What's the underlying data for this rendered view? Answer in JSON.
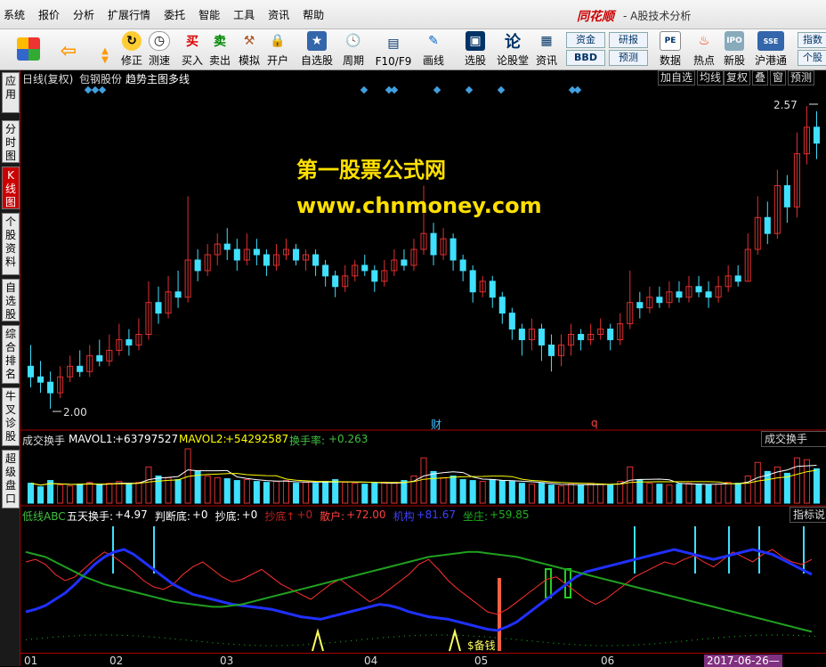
{
  "menubar": {
    "items": [
      "系统",
      "报价",
      "分析",
      "扩展行情",
      "委托",
      "智能",
      "工具",
      "资讯",
      "帮助"
    ],
    "brand": "同花顺",
    "subtitle": "- A股技术分析"
  },
  "toolbar": {
    "buttons": [
      {
        "label": "修正"
      },
      {
        "label": "测速"
      },
      {
        "label": "买入"
      },
      {
        "label": "卖出"
      },
      {
        "label": "模拟"
      },
      {
        "label": "开户"
      },
      {
        "label": "自选股"
      },
      {
        "label": "周期"
      },
      {
        "label": "F10/F9"
      },
      {
        "label": "画线"
      },
      {
        "label": "选股"
      },
      {
        "label": "论股堂"
      },
      {
        "label": "资讯"
      },
      {
        "label": "数据"
      },
      {
        "label": "热点"
      },
      {
        "label": "新股"
      },
      {
        "label": "沪港通"
      },
      {
        "label": "个股"
      }
    ],
    "boxes": [
      "资金",
      "研报",
      "BBD",
      "预测",
      "指数"
    ],
    "icon_glyphs": {
      "buy": "买",
      "sell": "卖",
      "lun": "论"
    }
  },
  "sidetabs": [
    "应用",
    "分时图",
    "K线图",
    "个股资料",
    "自选股",
    "综合排名",
    "牛叉诊股",
    "超级盘口"
  ],
  "header": {
    "period": "日线(复权)",
    "stock": "包钢股份",
    "indicator": "趋势主图多线",
    "buttons": [
      "加自选",
      "均线",
      "复权",
      "叠",
      "窗",
      "预测"
    ]
  },
  "watermark": {
    "line1": "第一股票公式网",
    "line2": "www.chnmoney.com"
  },
  "kline": {
    "high_label": "2.57",
    "low_label": "2.00",
    "markers": [
      "财",
      "q"
    ]
  },
  "volume_panel": {
    "name": "成交换手",
    "mavol1_label": "MAVOL1:",
    "mavol1_value": "+63797527",
    "mavol2_label": "MAVOL2:",
    "mavol2_value": "+54292587",
    "turnover_label": "换手率:",
    "turnover_value": "+0.263",
    "right_button": "成交换手"
  },
  "indicator_panel": {
    "name": "低线ABC",
    "items": [
      {
        "label": "五天换手:",
        "value": "+4.97",
        "color": "#ffffff"
      },
      {
        "label": "判断底:",
        "value": "+0",
        "color": "#ffffff"
      },
      {
        "label": "抄底:",
        "value": "+0",
        "color": "#ffffff"
      },
      {
        "label": "抄底↑",
        "value": "+0",
        "color": "#c02020"
      },
      {
        "label": "散户:",
        "value": "+72.00",
        "color": "#ff4040"
      },
      {
        "label": "机构",
        "value": "+81.67",
        "color": "#4040ff"
      },
      {
        "label": "坐庄:",
        "value": "+59.85",
        "color": "#20b020"
      }
    ],
    "right_button": "指标说明",
    "annotations": [
      "$备钱",
      "$备钱"
    ]
  },
  "dates": [
    "01",
    "02",
    "03",
    "04",
    "05",
    "06",
    "2017-06-26—"
  ],
  "colors": {
    "up": "#e03030",
    "down": "#40e0ff",
    "volume_ma1": "#ffffff",
    "volume_ma2": "#ffff00",
    "retail": "#ff3030",
    "institution": "#2030ff",
    "banker": "#20a020"
  },
  "chart_data": {
    "type": "candlestick",
    "price_range": [
      2.0,
      2.57
    ],
    "candles": [
      {
        "o": 2.08,
        "c": 2.06,
        "h": 2.12,
        "l": 2.04
      },
      {
        "o": 2.06,
        "c": 2.05,
        "h": 2.09,
        "l": 2.03
      },
      {
        "o": 2.05,
        "c": 2.03,
        "h": 2.07,
        "l": 2.0
      },
      {
        "o": 2.03,
        "c": 2.06,
        "h": 2.08,
        "l": 2.02
      },
      {
        "o": 2.06,
        "c": 2.08,
        "h": 2.1,
        "l": 2.05
      },
      {
        "o": 2.08,
        "c": 2.07,
        "h": 2.11,
        "l": 2.06
      },
      {
        "o": 2.07,
        "c": 2.1,
        "h": 2.12,
        "l": 2.06
      },
      {
        "o": 2.1,
        "c": 2.09,
        "h": 2.13,
        "l": 2.08
      },
      {
        "o": 2.09,
        "c": 2.11,
        "h": 2.14,
        "l": 2.08
      },
      {
        "o": 2.11,
        "c": 2.13,
        "h": 2.16,
        "l": 2.1
      },
      {
        "o": 2.13,
        "c": 2.12,
        "h": 2.15,
        "l": 2.1
      },
      {
        "o": 2.12,
        "c": 2.14,
        "h": 2.17,
        "l": 2.11
      },
      {
        "o": 2.14,
        "c": 2.2,
        "h": 2.24,
        "l": 2.13
      },
      {
        "o": 2.2,
        "c": 2.18,
        "h": 2.23,
        "l": 2.16
      },
      {
        "o": 2.18,
        "c": 2.22,
        "h": 2.25,
        "l": 2.17
      },
      {
        "o": 2.22,
        "c": 2.21,
        "h": 2.26,
        "l": 2.19
      },
      {
        "o": 2.21,
        "c": 2.28,
        "h": 2.4,
        "l": 2.2
      },
      {
        "o": 2.28,
        "c": 2.26,
        "h": 2.3,
        "l": 2.24
      },
      {
        "o": 2.26,
        "c": 2.29,
        "h": 2.31,
        "l": 2.25
      },
      {
        "o": 2.29,
        "c": 2.31,
        "h": 2.33,
        "l": 2.27
      },
      {
        "o": 2.31,
        "c": 2.3,
        "h": 2.34,
        "l": 2.28
      },
      {
        "o": 2.3,
        "c": 2.28,
        "h": 2.32,
        "l": 2.26
      },
      {
        "o": 2.28,
        "c": 2.3,
        "h": 2.33,
        "l": 2.27
      },
      {
        "o": 2.3,
        "c": 2.29,
        "h": 2.32,
        "l": 2.27
      },
      {
        "o": 2.29,
        "c": 2.27,
        "h": 2.3,
        "l": 2.25
      },
      {
        "o": 2.27,
        "c": 2.29,
        "h": 2.31,
        "l": 2.26
      },
      {
        "o": 2.29,
        "c": 2.3,
        "h": 2.32,
        "l": 2.28
      },
      {
        "o": 2.3,
        "c": 2.28,
        "h": 2.31,
        "l": 2.27
      },
      {
        "o": 2.28,
        "c": 2.29,
        "h": 2.3,
        "l": 2.26
      },
      {
        "o": 2.29,
        "c": 2.27,
        "h": 2.3,
        "l": 2.25
      },
      {
        "o": 2.27,
        "c": 2.25,
        "h": 2.28,
        "l": 2.23
      },
      {
        "o": 2.25,
        "c": 2.23,
        "h": 2.26,
        "l": 2.21
      },
      {
        "o": 2.23,
        "c": 2.25,
        "h": 2.27,
        "l": 2.22
      },
      {
        "o": 2.25,
        "c": 2.27,
        "h": 2.28,
        "l": 2.24
      },
      {
        "o": 2.27,
        "c": 2.26,
        "h": 2.29,
        "l": 2.25
      },
      {
        "o": 2.26,
        "c": 2.24,
        "h": 2.27,
        "l": 2.22
      },
      {
        "o": 2.24,
        "c": 2.26,
        "h": 2.28,
        "l": 2.23
      },
      {
        "o": 2.26,
        "c": 2.28,
        "h": 2.3,
        "l": 2.25
      },
      {
        "o": 2.28,
        "c": 2.27,
        "h": 2.3,
        "l": 2.26
      },
      {
        "o": 2.27,
        "c": 2.3,
        "h": 2.32,
        "l": 2.26
      },
      {
        "o": 2.3,
        "c": 2.33,
        "h": 2.42,
        "l": 2.29
      },
      {
        "o": 2.33,
        "c": 2.29,
        "h": 2.35,
        "l": 2.27
      },
      {
        "o": 2.29,
        "c": 2.32,
        "h": 2.34,
        "l": 2.28
      },
      {
        "o": 2.32,
        "c": 2.28,
        "h": 2.33,
        "l": 2.26
      },
      {
        "o": 2.28,
        "c": 2.26,
        "h": 2.29,
        "l": 2.24
      },
      {
        "o": 2.26,
        "c": 2.22,
        "h": 2.27,
        "l": 2.2
      },
      {
        "o": 2.22,
        "c": 2.24,
        "h": 2.25,
        "l": 2.21
      },
      {
        "o": 2.24,
        "c": 2.21,
        "h": 2.25,
        "l": 2.19
      },
      {
        "o": 2.21,
        "c": 2.18,
        "h": 2.22,
        "l": 2.16
      },
      {
        "o": 2.18,
        "c": 2.15,
        "h": 2.19,
        "l": 2.13
      },
      {
        "o": 2.15,
        "c": 2.13,
        "h": 2.16,
        "l": 2.1
      },
      {
        "o": 2.13,
        "c": 2.15,
        "h": 2.17,
        "l": 2.11
      },
      {
        "o": 2.15,
        "c": 2.12,
        "h": 2.16,
        "l": 2.09
      },
      {
        "o": 2.12,
        "c": 2.1,
        "h": 2.14,
        "l": 2.07
      },
      {
        "o": 2.1,
        "c": 2.12,
        "h": 2.14,
        "l": 2.08
      },
      {
        "o": 2.12,
        "c": 2.14,
        "h": 2.16,
        "l": 2.1
      },
      {
        "o": 2.14,
        "c": 2.13,
        "h": 2.15,
        "l": 2.11
      },
      {
        "o": 2.13,
        "c": 2.14,
        "h": 2.16,
        "l": 2.12
      },
      {
        "o": 2.14,
        "c": 2.15,
        "h": 2.17,
        "l": 2.13
      },
      {
        "o": 2.15,
        "c": 2.13,
        "h": 2.16,
        "l": 2.11
      },
      {
        "o": 2.13,
        "c": 2.16,
        "h": 2.18,
        "l": 2.12
      },
      {
        "o": 2.16,
        "c": 2.2,
        "h": 2.26,
        "l": 2.15
      },
      {
        "o": 2.2,
        "c": 2.19,
        "h": 2.22,
        "l": 2.17
      },
      {
        "o": 2.19,
        "c": 2.21,
        "h": 2.23,
        "l": 2.18
      },
      {
        "o": 2.21,
        "c": 2.2,
        "h": 2.23,
        "l": 2.19
      },
      {
        "o": 2.2,
        "c": 2.22,
        "h": 2.24,
        "l": 2.19
      },
      {
        "o": 2.22,
        "c": 2.21,
        "h": 2.24,
        "l": 2.2
      },
      {
        "o": 2.21,
        "c": 2.23,
        "h": 2.25,
        "l": 2.2
      },
      {
        "o": 2.23,
        "c": 2.22,
        "h": 2.25,
        "l": 2.21
      },
      {
        "o": 2.22,
        "c": 2.21,
        "h": 2.24,
        "l": 2.19
      },
      {
        "o": 2.21,
        "c": 2.23,
        "h": 2.25,
        "l": 2.2
      },
      {
        "o": 2.23,
        "c": 2.25,
        "h": 2.27,
        "l": 2.22
      },
      {
        "o": 2.25,
        "c": 2.24,
        "h": 2.27,
        "l": 2.23
      },
      {
        "o": 2.24,
        "c": 2.3,
        "h": 2.33,
        "l": 2.24
      },
      {
        "o": 2.3,
        "c": 2.36,
        "h": 2.4,
        "l": 2.29
      },
      {
        "o": 2.36,
        "c": 2.33,
        "h": 2.39,
        "l": 2.31
      },
      {
        "o": 2.33,
        "c": 2.42,
        "h": 2.45,
        "l": 2.32
      },
      {
        "o": 2.42,
        "c": 2.38,
        "h": 2.44,
        "l": 2.35
      },
      {
        "o": 2.38,
        "c": 2.48,
        "h": 2.52,
        "l": 2.36
      },
      {
        "o": 2.48,
        "c": 2.53,
        "h": 2.57,
        "l": 2.46
      },
      {
        "o": 2.53,
        "c": 2.5,
        "h": 2.56,
        "l": 2.47
      }
    ],
    "volume": [
      22,
      18,
      25,
      20,
      19,
      21,
      23,
      20,
      22,
      24,
      21,
      23,
      40,
      30,
      28,
      26,
      60,
      35,
      30,
      28,
      27,
      25,
      26,
      24,
      23,
      24,
      25,
      22,
      23,
      22,
      24,
      26,
      23,
      22,
      21,
      22,
      23,
      22,
      25,
      30,
      50,
      35,
      28,
      30,
      26,
      25,
      24,
      26,
      25,
      24,
      22,
      21,
      22,
      20,
      19,
      21,
      20,
      22,
      21,
      20,
      24,
      40,
      26,
      22,
      21,
      20,
      21,
      22,
      21,
      20,
      21,
      23,
      22,
      30,
      45,
      35,
      40,
      33,
      50,
      48,
      38
    ],
    "series": [
      {
        "name": "散户",
        "values": [
          70,
          72,
          68,
          60,
          55,
          58,
          65,
          72,
          78,
          74,
          68,
          62,
          55,
          50,
          48,
          52,
          60,
          66,
          70,
          64,
          58,
          54,
          56,
          60,
          64,
          58,
          52,
          48,
          44,
          40,
          46,
          52,
          56,
          50,
          44,
          38,
          42,
          48,
          54,
          60,
          68,
          72,
          64,
          55,
          48,
          42,
          36,
          30,
          28,
          32,
          38,
          44,
          50,
          56,
          58,
          52,
          46,
          40,
          36,
          40,
          46,
          52,
          58,
          62,
          66,
          70,
          68,
          72,
          75,
          70,
          66,
          72,
          78,
          74,
          70,
          76,
          80,
          74,
          70,
          68,
          72
        ]
      },
      {
        "name": "机构",
        "values": [
          30,
          32,
          35,
          40,
          45,
          52,
          60,
          68,
          74,
          78,
          80,
          76,
          70,
          64,
          58,
          52,
          48,
          44,
          42,
          40,
          38,
          36,
          35,
          34,
          33,
          32,
          30,
          28,
          26,
          25,
          24,
          26,
          28,
          30,
          32,
          34,
          36,
          35,
          33,
          30,
          28,
          26,
          25,
          24,
          22,
          20,
          18,
          16,
          15,
          18,
          22,
          28,
          34,
          40,
          46,
          52,
          58,
          62,
          64,
          66,
          68,
          70,
          72,
          74,
          76,
          78,
          80,
          78,
          76,
          74,
          72,
          74,
          76,
          78,
          80,
          78,
          76,
          72,
          68,
          64,
          60
        ]
      },
      {
        "name": "坐庄",
        "values": [
          78,
          76,
          74,
          70,
          66,
          62,
          58,
          55,
          52,
          50,
          48,
          46,
          44,
          42,
          40,
          38,
          37,
          36,
          35,
          34,
          34,
          35,
          36,
          38,
          40,
          42,
          44,
          46,
          48,
          50,
          52,
          54,
          56,
          58,
          60,
          62,
          64,
          66,
          68,
          70,
          72,
          74,
          75,
          76,
          77,
          78,
          78,
          77,
          76,
          75,
          74,
          72,
          70,
          68,
          66,
          64,
          62,
          60,
          58,
          56,
          54,
          52,
          50,
          48,
          46,
          44,
          42,
          40,
          38,
          36,
          34,
          32,
          30,
          28,
          26,
          24,
          22,
          20,
          18,
          16,
          14
        ]
      }
    ]
  }
}
